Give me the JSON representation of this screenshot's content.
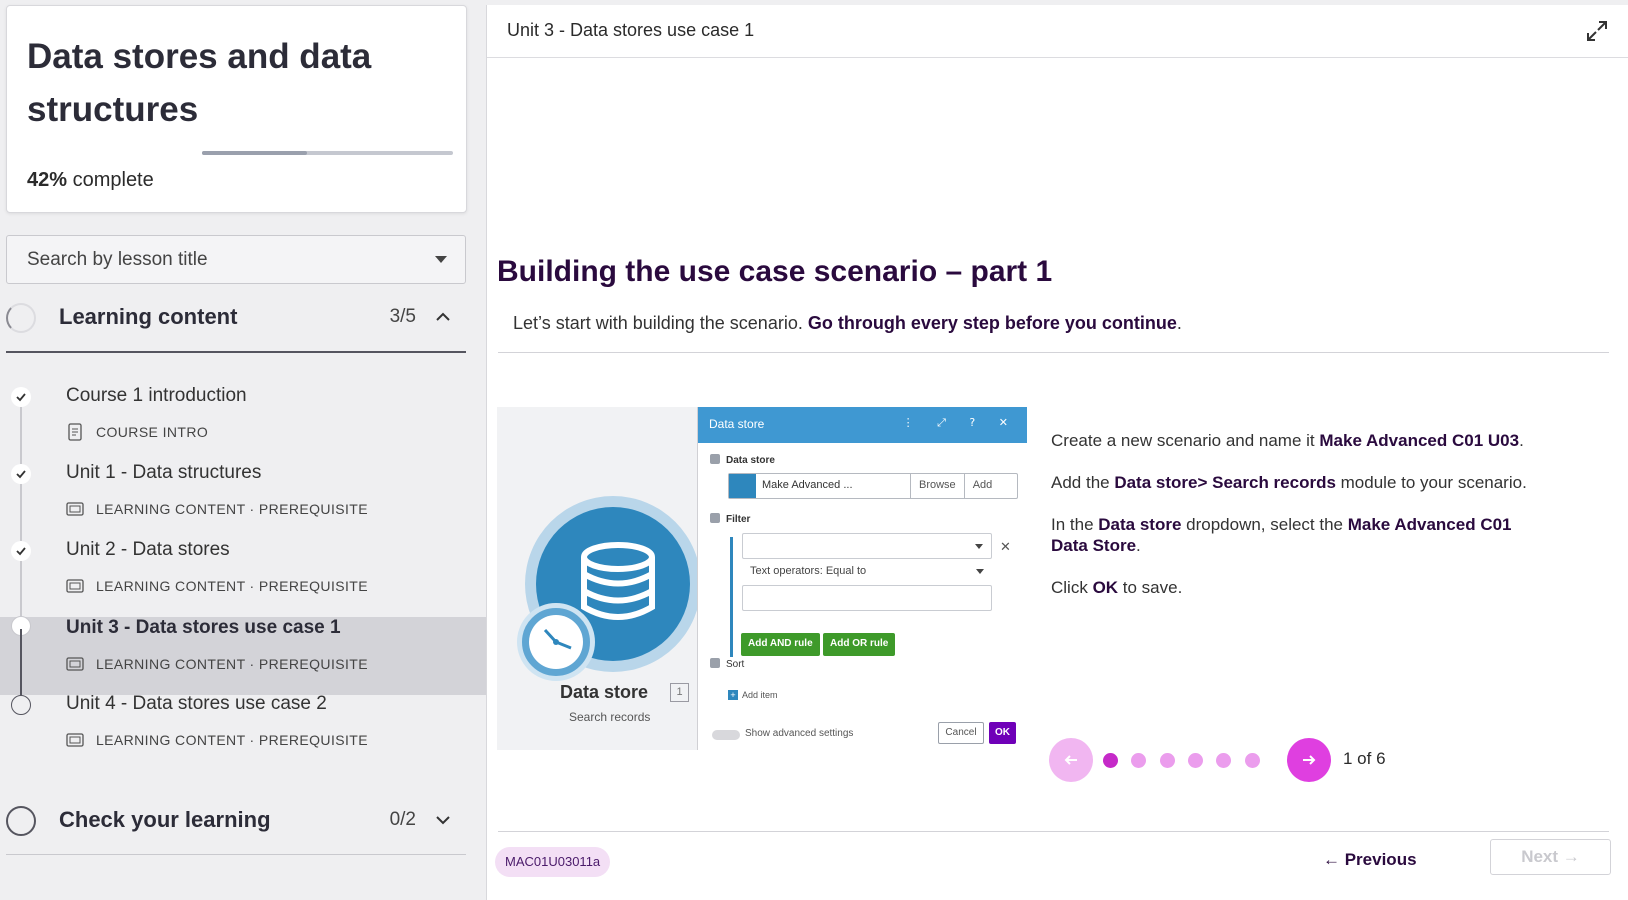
{
  "course": {
    "title": "Data stores and data structures",
    "progress_percent": 42,
    "progress_pct_label": "42%",
    "progress_suffix": " complete"
  },
  "search": {
    "placeholder": "Search by lesson title"
  },
  "sections": [
    {
      "label": "Learning content",
      "count": "3/5",
      "expanded": true,
      "lessons": [
        {
          "title": "Course 1 introduction",
          "meta": "COURSE INTRO",
          "status": "done",
          "icon": "document-icon"
        },
        {
          "title": "Unit 1 - Data structures",
          "meta": "LEARNING CONTENT · PREREQUISITE",
          "status": "done",
          "icon": "slides-icon"
        },
        {
          "title": "Unit 2 - Data stores",
          "meta": "LEARNING CONTENT · PREREQUISITE",
          "status": "done",
          "icon": "slides-icon"
        },
        {
          "title": "Unit 3 - Data stores use case 1",
          "meta": "LEARNING CONTENT · PREREQUISITE",
          "status": "current",
          "icon": "slides-icon"
        },
        {
          "title": "Unit 4 - Data stores use case 2",
          "meta": "LEARNING CONTENT · PREREQUISITE",
          "status": "todo",
          "icon": "slides-icon"
        }
      ]
    },
    {
      "label": "Check your learning",
      "count": "0/2",
      "expanded": false
    }
  ],
  "main": {
    "header_title": "Unit 3 - Data stores use case 1",
    "heading": "Building the use case scenario – part 1",
    "intro_plain": "Let’s start with building the scenario. ",
    "intro_bold": "Go through every step before you continue",
    "intro_end": "."
  },
  "figure": {
    "module_label": "Data store",
    "module_badge": "1",
    "module_sub": "Search records",
    "dialog": {
      "title": "Data store",
      "header_icons": "⋮ ⤢ ? ✕",
      "section_datastore": "Data store",
      "datastore_value": "Make Advanced ...",
      "browse": "Browse",
      "add": "Add",
      "section_filter": "Filter",
      "operator": "Text operators: Equal to",
      "add_and": "Add AND rule",
      "add_or": "Add OR rule",
      "section_sort": "Sort",
      "add_item": "Add item",
      "show_advanced": "Show advanced settings",
      "cancel": "Cancel",
      "ok": "OK"
    }
  },
  "steps": {
    "s1_a": "Create a new scenario and name it ",
    "s1_b": "Make Advanced C01 U03",
    "s1_c": ".",
    "s2_a": "Add the ",
    "s2_b": "Data store> Search records",
    "s2_c": " module to your scenario.",
    "s3_a": "In the ",
    "s3_b": "Data store",
    "s3_c": " dropdown, select the ",
    "s3_d": "Make Advanced C01 Data Store",
    "s3_e": ".",
    "s4_a": "Click ",
    "s4_b": "OK",
    "s4_c": " to save."
  },
  "carousel": {
    "current": 1,
    "total": 6,
    "label": "1 of 6"
  },
  "footer": {
    "code": "MAC01U03011a",
    "previous": "← Previous",
    "next": "Next →"
  },
  "colors": {
    "accent": "#df3fe0",
    "heading": "#2a0a3e",
    "dialog_blue": "#3f98d2",
    "ok_purple": "#6f00b8"
  }
}
